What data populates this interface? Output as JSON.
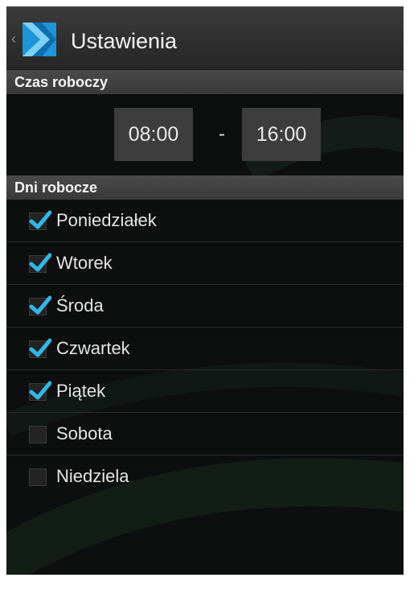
{
  "colors": {
    "accent": "#33b5e5",
    "background": "#0d0f0e"
  },
  "action_bar": {
    "title": "Ustawienia",
    "back_icon": "chevron-left-icon",
    "logo_icon": "app-chevron-logo-icon"
  },
  "working_time": {
    "header": "Czas roboczy",
    "start": "08:00",
    "separator": "-",
    "end": "16:00"
  },
  "working_days": {
    "header": "Dni robocze",
    "items": [
      {
        "label": "Poniedziałek",
        "checked": true
      },
      {
        "label": "Wtorek",
        "checked": true
      },
      {
        "label": "Środa",
        "checked": true
      },
      {
        "label": "Czwartek",
        "checked": true
      },
      {
        "label": "Piątek",
        "checked": true
      },
      {
        "label": "Sobota",
        "checked": false
      },
      {
        "label": "Niedziela",
        "checked": false
      }
    ]
  }
}
